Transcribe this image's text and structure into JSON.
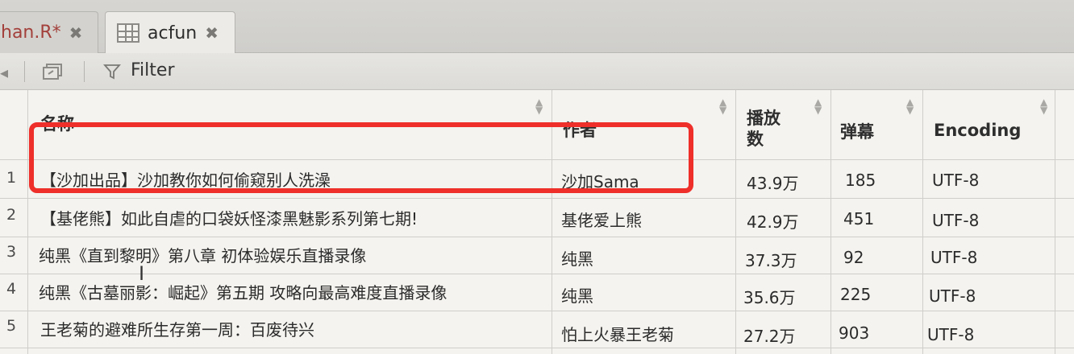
{
  "tabs": [
    {
      "label": "han.R*",
      "close": "✖"
    },
    {
      "label": "acfun",
      "close": "✖"
    }
  ],
  "toolbar": {
    "filter_label": "Filter"
  },
  "columns": [
    {
      "label": "名称"
    },
    {
      "label": "作者"
    },
    {
      "label": "播放数"
    },
    {
      "label": "弹幕"
    },
    {
      "label": "Encoding"
    }
  ],
  "rows": [
    {
      "num": "1",
      "title": "【沙加出品】沙加教你如何偷窥别人洗澡",
      "author": "沙加Sama",
      "plays": "43.9万",
      "danmaku": "185",
      "encoding": "UTF-8"
    },
    {
      "num": "2",
      "title": "【基佬熊】如此自虐的口袋妖怪漆黑魅影系列第七期!",
      "author": "基佬爱上熊",
      "plays": "42.9万",
      "danmaku": "451",
      "encoding": "UTF-8"
    },
    {
      "num": "3",
      "title": "纯黑《直到黎明》第八章 初体验娱乐直播录像",
      "author": "纯黑",
      "plays": "37.3万",
      "danmaku": "92",
      "encoding": "UTF-8"
    },
    {
      "num": "4",
      "title": "纯黑《古墓丽影：崛起》第五期 攻略向最高难度直播录像",
      "author": "纯黑",
      "plays": "35.6万",
      "danmaku": "225",
      "encoding": "UTF-8"
    },
    {
      "num": "5",
      "title": "王老菊的避难所生存第一周：百废待兴",
      "author": "怕上火暴王老菊",
      "plays": "27.2万",
      "danmaku": "903",
      "encoding": "UTF-8"
    }
  ],
  "colors": {
    "highlight": "#ee2f2a",
    "tab_modified": "#a3403b"
  }
}
